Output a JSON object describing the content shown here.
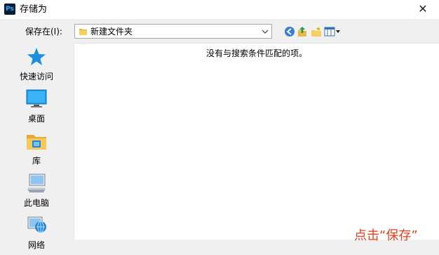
{
  "window": {
    "title": "存储为",
    "app_icon_label": "Ps",
    "close_glyph": "✕"
  },
  "toolbar": {
    "save_in_label": "保存在(I):",
    "location_value": "新建文件夹"
  },
  "places": [
    {
      "label": "快速访问",
      "icon": "star-icon"
    },
    {
      "label": "桌面",
      "icon": "desktop-icon"
    },
    {
      "label": "库",
      "icon": "library-icon"
    },
    {
      "label": "此电脑",
      "icon": "computer-icon"
    },
    {
      "label": "网络",
      "icon": "network-icon"
    }
  ],
  "file_pane": {
    "empty_message": "没有与搜索条件匹配的项。"
  },
  "annotation": {
    "text": "点击“保存”",
    "color": "#e8401c"
  },
  "colors": {
    "background": "#f0f0f0",
    "ps_dark": "#001e36",
    "ps_blue": "#31a8ff"
  }
}
